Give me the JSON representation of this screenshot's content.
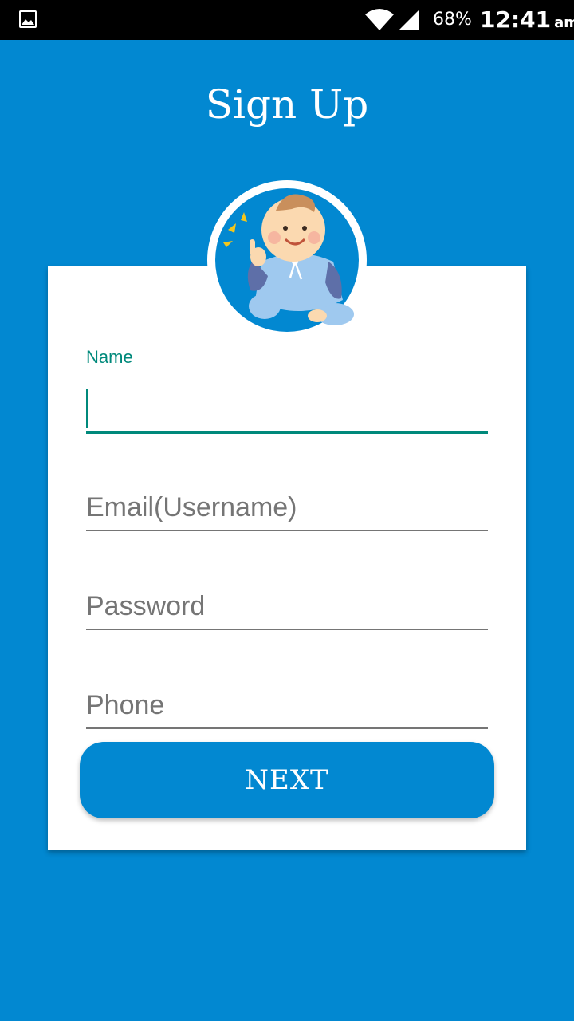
{
  "status_bar": {
    "battery": "68%",
    "time": "12:41",
    "ampm": "am",
    "icons": [
      "gallery-icon",
      "wifi-icon",
      "signal-icon"
    ]
  },
  "page": {
    "title": "Sign Up"
  },
  "avatar": {
    "icon": "baby-avatar-icon"
  },
  "form": {
    "name_label": "Name",
    "name_value": "",
    "email_placeholder": "Email(Username)",
    "password_placeholder": "Password",
    "phone_placeholder": "Phone",
    "next_label": "NEXT"
  },
  "colors": {
    "primary": "#0288d1",
    "accent": "#00897b",
    "card": "#ffffff"
  }
}
